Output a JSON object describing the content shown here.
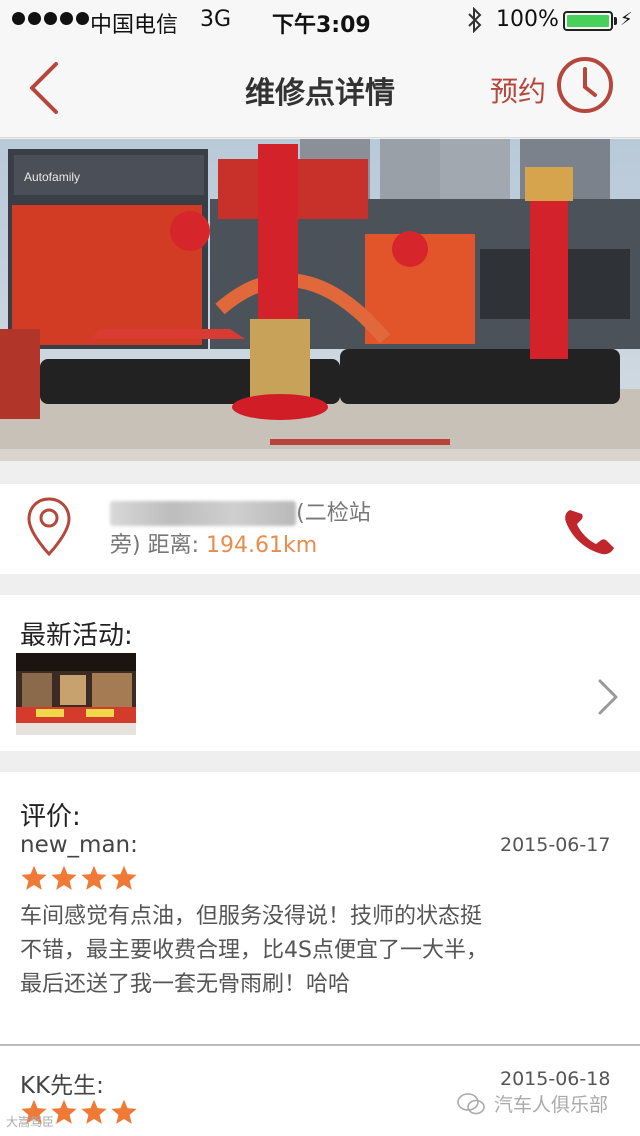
{
  "status_bar": {
    "carrier": "中国电信",
    "network": "3G",
    "time": "下午3:09",
    "battery": "100%"
  },
  "nav": {
    "title": "维修点详情",
    "book_label": "预约",
    "back_icon": "chevron-left-icon",
    "clock_icon": "clock-icon"
  },
  "address": {
    "text_visible_1": "(二检站",
    "text_visible_2": "旁)",
    "distance_label": "距离:",
    "distance_value": "194.61km"
  },
  "activity": {
    "title": "最新活动:"
  },
  "reviews": {
    "title": "评价:",
    "items": [
      {
        "user": "new_man:",
        "date": "2015-06-17",
        "rating": 4,
        "text": "车间感觉有点油，但服务没得说！技师的状态挺不错，最主要收费合理，比4S点便宜了一大半，最后还送了我一套无骨雨刷！哈哈"
      },
      {
        "user": "KK先生:",
        "date": "2015-06-18",
        "rating": 4,
        "text": ""
      }
    ]
  },
  "watermark": {
    "left": "大嵩驾臣",
    "right": "汽车人俱乐部"
  },
  "colors": {
    "accent_red": "#b5473c",
    "star_orange": "#f07a35",
    "distance_orange": "#e98c4e"
  }
}
